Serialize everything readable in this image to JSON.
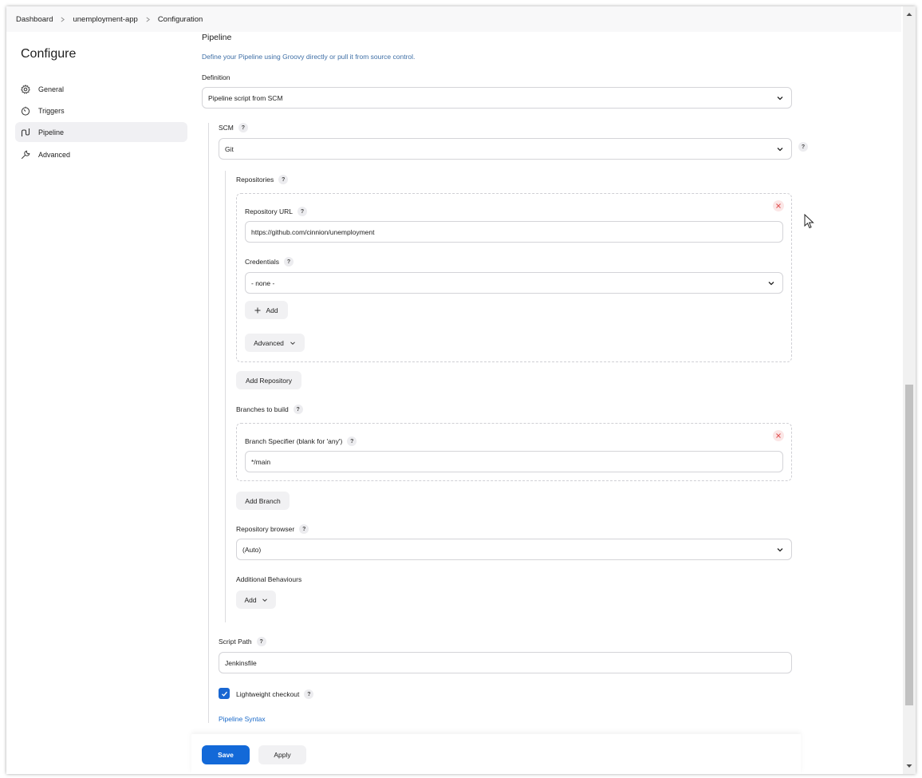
{
  "breadcrumb": {
    "items": [
      "Dashboard",
      "unemployment-app",
      "Configuration"
    ]
  },
  "sidebar": {
    "title": "Configure",
    "items": [
      {
        "label": "General",
        "icon": "gear-icon"
      },
      {
        "label": "Triggers",
        "icon": "timer-icon"
      },
      {
        "label": "Pipeline",
        "icon": "pipeline-icon",
        "active": true
      },
      {
        "label": "Advanced",
        "icon": "wrench-icon"
      }
    ]
  },
  "pipeline": {
    "title": "Pipeline",
    "description": "Define your Pipeline using Groovy directly or pull it from source control.",
    "definition_label": "Definition",
    "definition_value": "Pipeline script from SCM",
    "scm_label": "SCM",
    "scm_value": "Git",
    "repositories_label": "Repositories",
    "repository_url_label": "Repository URL",
    "repository_url_value": "https://github.com/cinnion/unemployment",
    "credentials_label": "Credentials",
    "credentials_value": "- none -",
    "add_credentials_label": "Add",
    "advanced_label": "Advanced",
    "add_repository_label": "Add Repository",
    "branches_label": "Branches to build",
    "branch_specifier_label": "Branch Specifier (blank for 'any')",
    "branch_specifier_value": "*/main",
    "add_branch_label": "Add Branch",
    "repository_browser_label": "Repository browser",
    "repository_browser_value": "(Auto)",
    "additional_behaviours_label": "Additional Behaviours",
    "add_behaviour_label": "Add",
    "script_path_label": "Script Path",
    "script_path_value": "Jenkinsfile",
    "lightweight_checkout_label": "Lightweight checkout",
    "lightweight_checkout_checked": true,
    "pipeline_syntax_link": "Pipeline Syntax"
  },
  "actions": {
    "save_label": "Save",
    "apply_label": "Apply"
  },
  "help_glyph": "?",
  "colors": {
    "accent": "#1369d8",
    "link": "#1b6ac9",
    "description": "#3f6fa6",
    "remove": "#e15656"
  }
}
